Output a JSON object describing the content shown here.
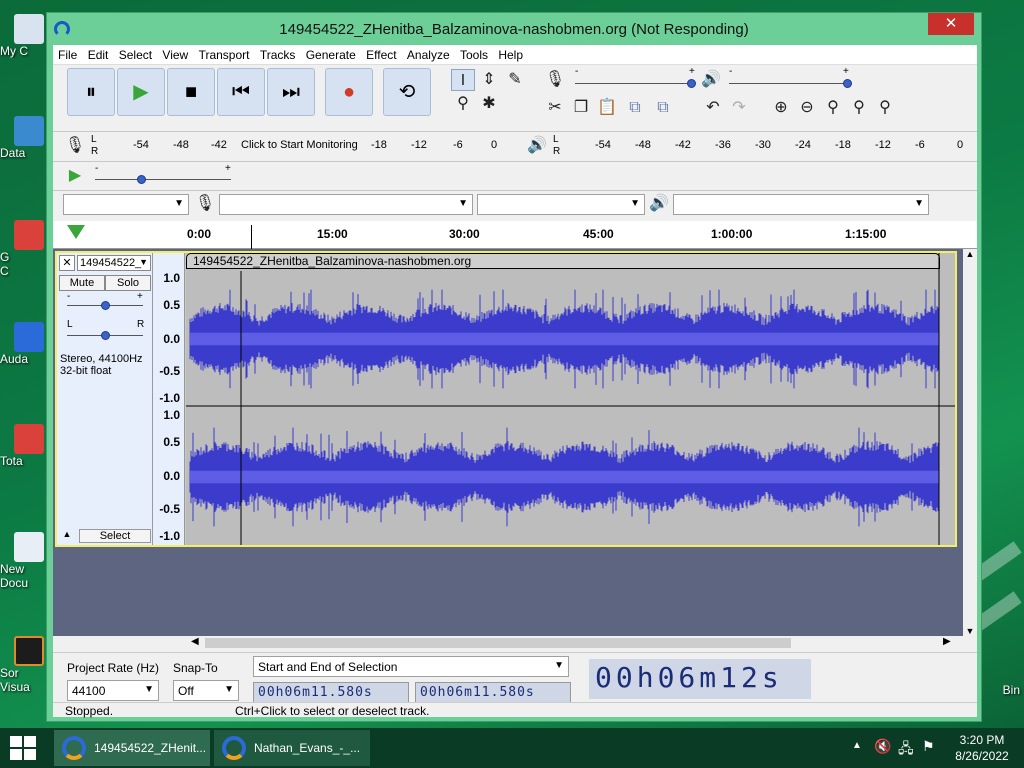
{
  "window": {
    "title": "149454522_ZHenitba_Balzaminova-nashobmen.org (Not Responding)",
    "close_label": "✕"
  },
  "menu": [
    "File",
    "Edit",
    "Select",
    "View",
    "Transport",
    "Tracks",
    "Generate",
    "Effect",
    "Analyze",
    "Tools",
    "Help"
  ],
  "transport": {
    "pause_icon": "⏸",
    "play_icon": "▶",
    "stop_icon": "■",
    "skip_start_icon": "⏮",
    "skip_end_icon": "⏭",
    "record_icon": "●",
    "loop_icon": "⟲"
  },
  "tools": {
    "select_icon": "I",
    "envelope_icon": "⇕",
    "draw_icon": "✎",
    "zoom_icon": "⚲",
    "multi_icon": "✱",
    "cut_icon": "✂",
    "copy_icon": "❐",
    "paste_icon": "📋",
    "undo_icon": "↶",
    "redo_icon": "↷",
    "zoom_in_icon": "⊕",
    "zoom_out_icon": "⊖"
  },
  "meters": {
    "record_ticks": [
      "-54",
      "-48",
      "-42",
      "-18",
      "-12",
      "-6",
      "0"
    ],
    "monitor_label": "Click to Start Monitoring",
    "play_ticks": [
      "-54",
      "-48",
      "-42",
      "-36",
      "-30",
      "-24",
      "-18",
      "-12",
      "-6",
      "0"
    ],
    "lr": [
      "L",
      "R"
    ]
  },
  "playspeed": {
    "minus": "-",
    "plus": "+"
  },
  "devices": {
    "host": "",
    "recording": "",
    "channels": "",
    "playback": ""
  },
  "timeline": [
    "0:00",
    "15:00",
    "30:00",
    "45:00",
    "1:00:00",
    "1:15:00"
  ],
  "track": {
    "name": "149454522_",
    "clip_name": "149454522_ZHenitba_Balzaminova-nashobmen.org",
    "mute": "Mute",
    "solo": "Solo",
    "gain_minus": "-",
    "gain_plus": "+",
    "pan_l": "L",
    "pan_r": "R",
    "format_line1": "Stereo, 44100Hz",
    "format_line2": "32-bit float",
    "select": "Select",
    "scale": [
      "1.0",
      "0.5",
      "0.0",
      "-0.5",
      "-1.0"
    ],
    "colors": {
      "wave": "#3c3ccc",
      "rms": "#6b6bf0",
      "track_border": "#f2ee66"
    }
  },
  "selection": {
    "project_rate_label": "Project Rate (Hz)",
    "project_rate": "44100",
    "snap_label": "Snap-To",
    "snap_value": "Off",
    "mode": "Start and End of Selection",
    "start_time": "00h06m11.580s",
    "end_time": "00h06m11.580s",
    "audio_position": "00h06m12s"
  },
  "status": {
    "left": "Stopped.",
    "right": "Ctrl+Click to select or deselect track."
  },
  "desktop_icons": [
    "My C",
    "Data",
    "G\nC",
    "Auda",
    "Tota",
    "New\nDocu",
    "Sor\nVisua"
  ],
  "desktop_right": "Bin",
  "taskbar": {
    "items": [
      "149454522_ZHenit...",
      "Nathan_Evans_-_..."
    ],
    "time": "3:20 PM",
    "date": "8/26/2022"
  }
}
